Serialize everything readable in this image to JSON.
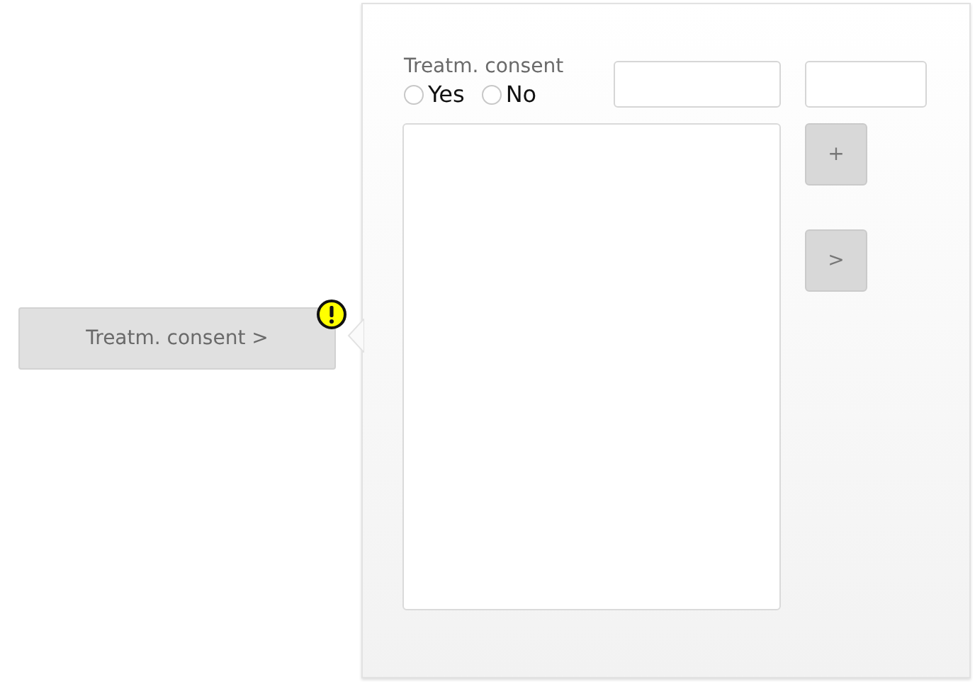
{
  "trigger": {
    "label": "Treatm. consent >",
    "warning": true
  },
  "popover": {
    "label": "Treatm. consent",
    "options": [
      {
        "label": "Yes",
        "selected": false
      },
      {
        "label": "No",
        "selected": false
      }
    ],
    "fields": [
      {
        "kind": "text"
      },
      {
        "kind": "text"
      }
    ],
    "list": {
      "kind": "listbox"
    },
    "buttons": [
      "+",
      ">"
    ]
  }
}
